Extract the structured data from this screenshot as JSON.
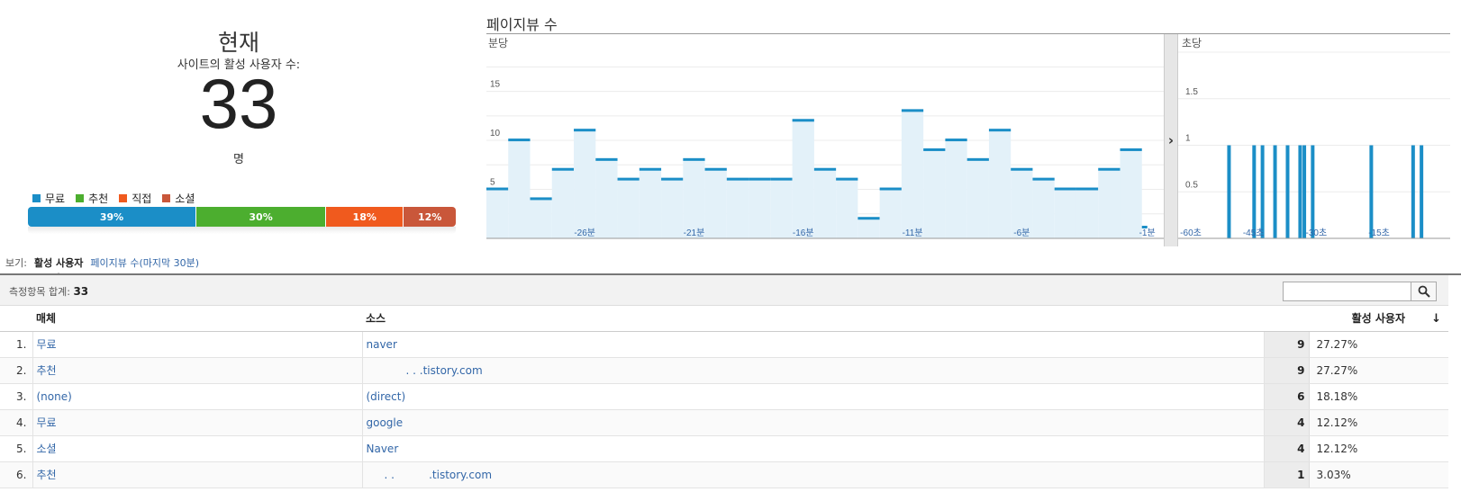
{
  "summary": {
    "title": "현재",
    "subtitle": "사이트의 활성 사용자 수:",
    "count": "33",
    "unit": "명",
    "legend": [
      {
        "label": "무료",
        "color": "#1b8ec7"
      },
      {
        "label": "추천",
        "color": "#4cae2f"
      },
      {
        "label": "직접",
        "color": "#f05a1e"
      },
      {
        "label": "소셜",
        "color": "#c9573a"
      }
    ],
    "breakdown": [
      {
        "label": "39%",
        "value": 39,
        "color": "#1b8ec7"
      },
      {
        "label": "30%",
        "value": 30,
        "color": "#4cae2f"
      },
      {
        "label": "18%",
        "value": 18,
        "color": "#f05a1e"
      },
      {
        "label": "12%",
        "value": 12,
        "color": "#c9573a"
      }
    ]
  },
  "pageviews": {
    "title": "페이지뷰 수",
    "per_minute_label": "분당",
    "per_second_label": "초당",
    "collapse_icon": "chevron-right-icon"
  },
  "chart_data": [
    {
      "type": "bar",
      "title": "분당",
      "x_tick_labels": [
        "-26분",
        "-21분",
        "-16분",
        "-11분",
        "-6분",
        "-1분"
      ],
      "y_ticks": [
        5,
        10,
        15
      ],
      "ylim": [
        0,
        19
      ],
      "grid": true,
      "values": [
        5,
        10,
        4,
        7,
        11,
        8,
        6,
        7,
        6,
        8,
        7,
        6,
        6,
        6,
        12,
        7,
        6,
        2,
        5,
        13,
        9,
        10,
        8,
        11,
        7,
        6,
        5,
        5,
        7,
        9,
        0
      ],
      "color": "#1b8ec7"
    },
    {
      "type": "bar",
      "title": "초당",
      "x_tick_labels": [
        "-60초",
        "-45초",
        "-30초",
        "-15초"
      ],
      "y_ticks": [
        0.5,
        1,
        1.5
      ],
      "ylim": [
        0,
        2
      ],
      "grid": true,
      "x": [
        -50,
        -44,
        -42,
        -39,
        -36,
        -33,
        -32,
        -30,
        -16,
        -6,
        -4
      ],
      "values": [
        1,
        1,
        1,
        1,
        1,
        1,
        1,
        1,
        1,
        1,
        1
      ],
      "color": "#1b8ec7"
    }
  ],
  "view": {
    "label": "보기:",
    "active": "활성 사용자",
    "alt": "페이지뷰 수(마지막 30분)"
  },
  "table": {
    "total_label": "측정항목 합계:",
    "total_value": "33",
    "search_placeholder": "",
    "headers": {
      "medium": "매체",
      "source": "소스",
      "metric": "활성 사용자"
    },
    "rows": [
      {
        "idx": "1.",
        "medium": "무료",
        "source": "naver",
        "value": "9",
        "pct": "27.27%"
      },
      {
        "idx": "2.",
        "medium": "추천",
        "source": ". . .tistory.com",
        "value": "9",
        "pct": "27.27%"
      },
      {
        "idx": "3.",
        "medium": "(none)",
        "source": "(direct)",
        "value": "6",
        "pct": "18.18%"
      },
      {
        "idx": "4.",
        "medium": "무료",
        "source": "google",
        "value": "4",
        "pct": "12.12%"
      },
      {
        "idx": "5.",
        "medium": "소셜",
        "source": "Naver",
        "value": "4",
        "pct": "12.12%"
      },
      {
        "idx": "6.",
        "medium": "추천",
        "source": ". .          .tistory.com",
        "value": "1",
        "pct": "3.03%"
      }
    ]
  }
}
